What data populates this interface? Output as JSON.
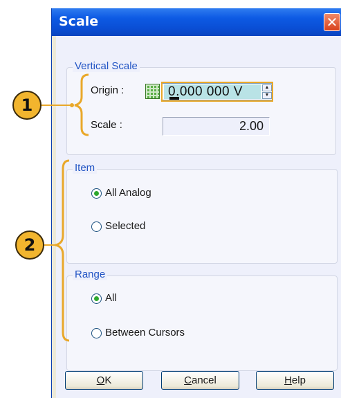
{
  "dialog": {
    "title": "Scale",
    "close_icon": "close-icon"
  },
  "vertical_scale": {
    "label": "Vertical Scale",
    "origin_label": "Origin :",
    "origin_value": "0.000 000 V",
    "scale_label": "Scale :",
    "scale_value": "2.00"
  },
  "item_group": {
    "label": "Item",
    "options": [
      "All Analog",
      "Selected"
    ],
    "selected": "All Analog"
  },
  "range_group": {
    "label": "Range",
    "options": [
      "All",
      "Between Cursors"
    ],
    "selected": "All"
  },
  "buttons": {
    "ok": {
      "rest": "K",
      "hotkey": "O"
    },
    "cancel": {
      "rest": "ancel",
      "hotkey": "C"
    },
    "help": {
      "rest": "elp",
      "hotkey": "H"
    }
  },
  "callouts": [
    "1",
    "2"
  ],
  "colors": {
    "title_bar": "#0a4fd6",
    "accent_label": "#2154c4",
    "callout": "#f2b52e",
    "bracket": "#e9a82a"
  }
}
